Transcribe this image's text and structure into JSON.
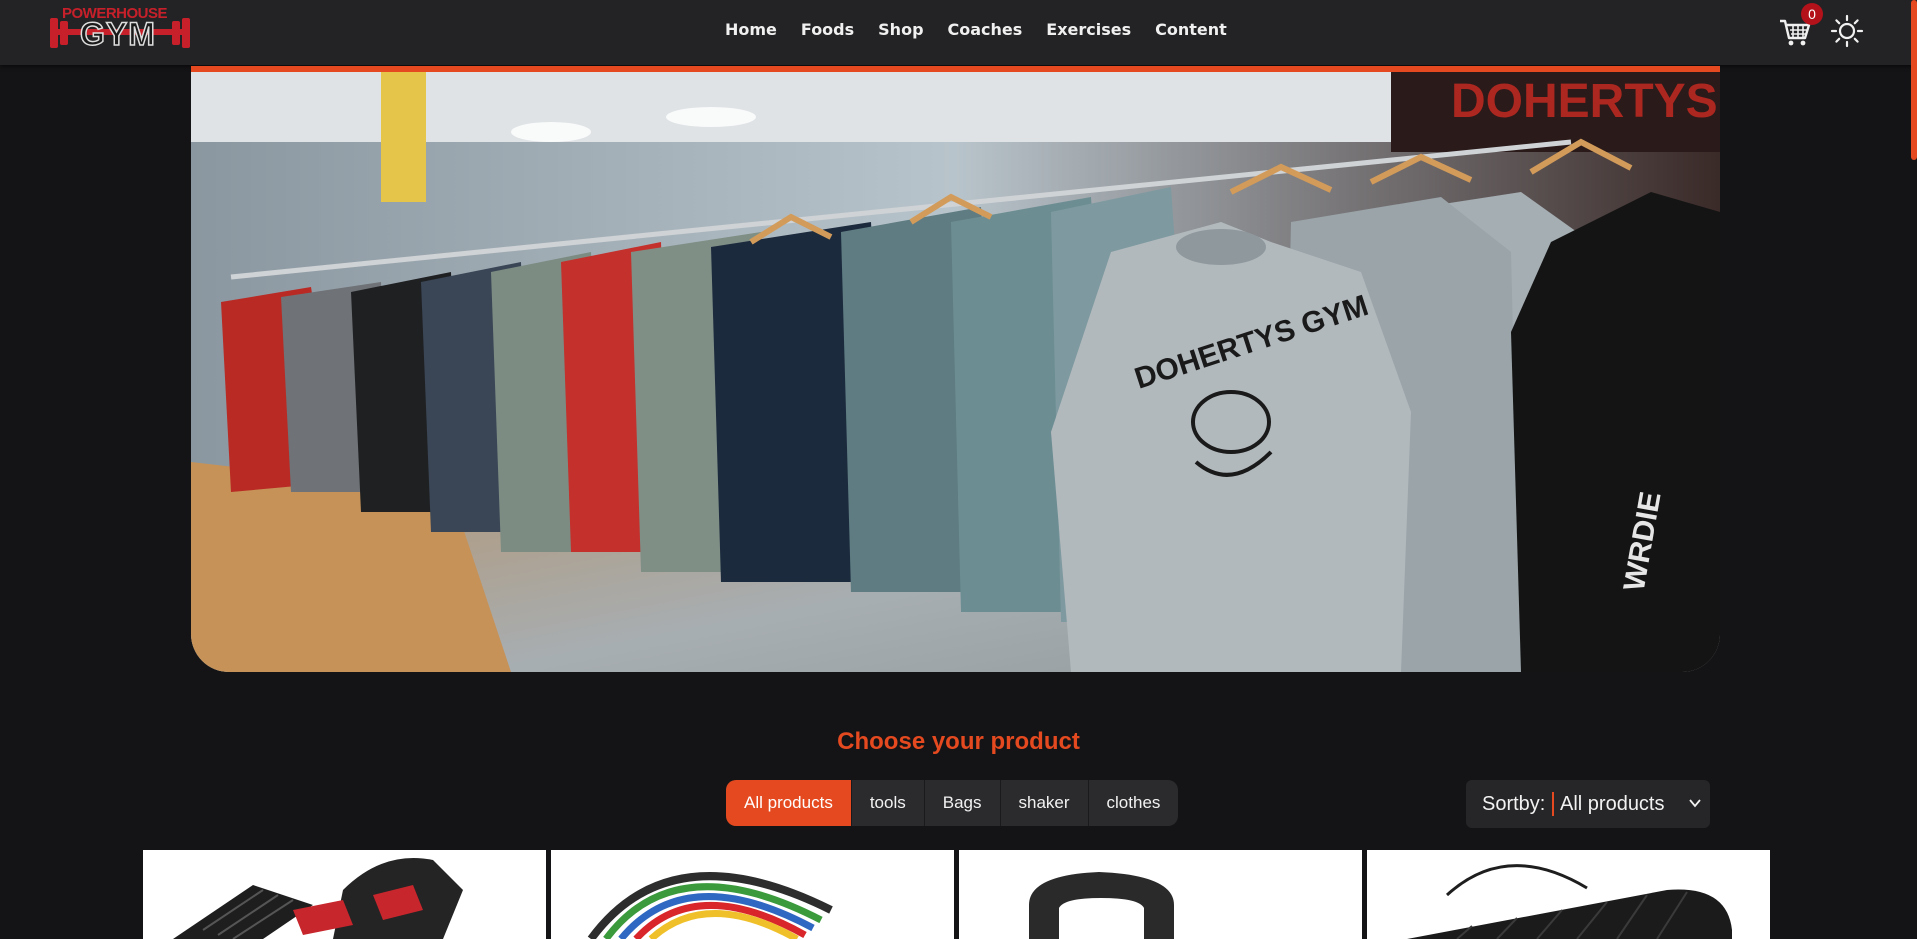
{
  "header": {
    "logo_top": "POWERHOUSE",
    "logo_main": "GYM",
    "nav": [
      "Home",
      "Foods",
      "Shop",
      "Coaches",
      "Exercises",
      "Content"
    ],
    "cart_count": "0",
    "icons": {
      "cart": "cart-icon",
      "theme": "sun-icon"
    }
  },
  "hero": {
    "image": "gym-clothing-rack-photo"
  },
  "products": {
    "title": "Choose your product",
    "filters": [
      "All products",
      "tools",
      "Bags",
      "shaker",
      "clothes"
    ],
    "active_filter": "All products",
    "sort_label": "Sortby:",
    "sort_value": "All products",
    "cards": [
      "adjustable-dumbbell",
      "resistance-bands",
      "kettlebell",
      "yoga-mat"
    ]
  },
  "colors": {
    "accent": "#e4491f",
    "background": "#141416",
    "header": "#232325",
    "badge": "#b3121b"
  }
}
